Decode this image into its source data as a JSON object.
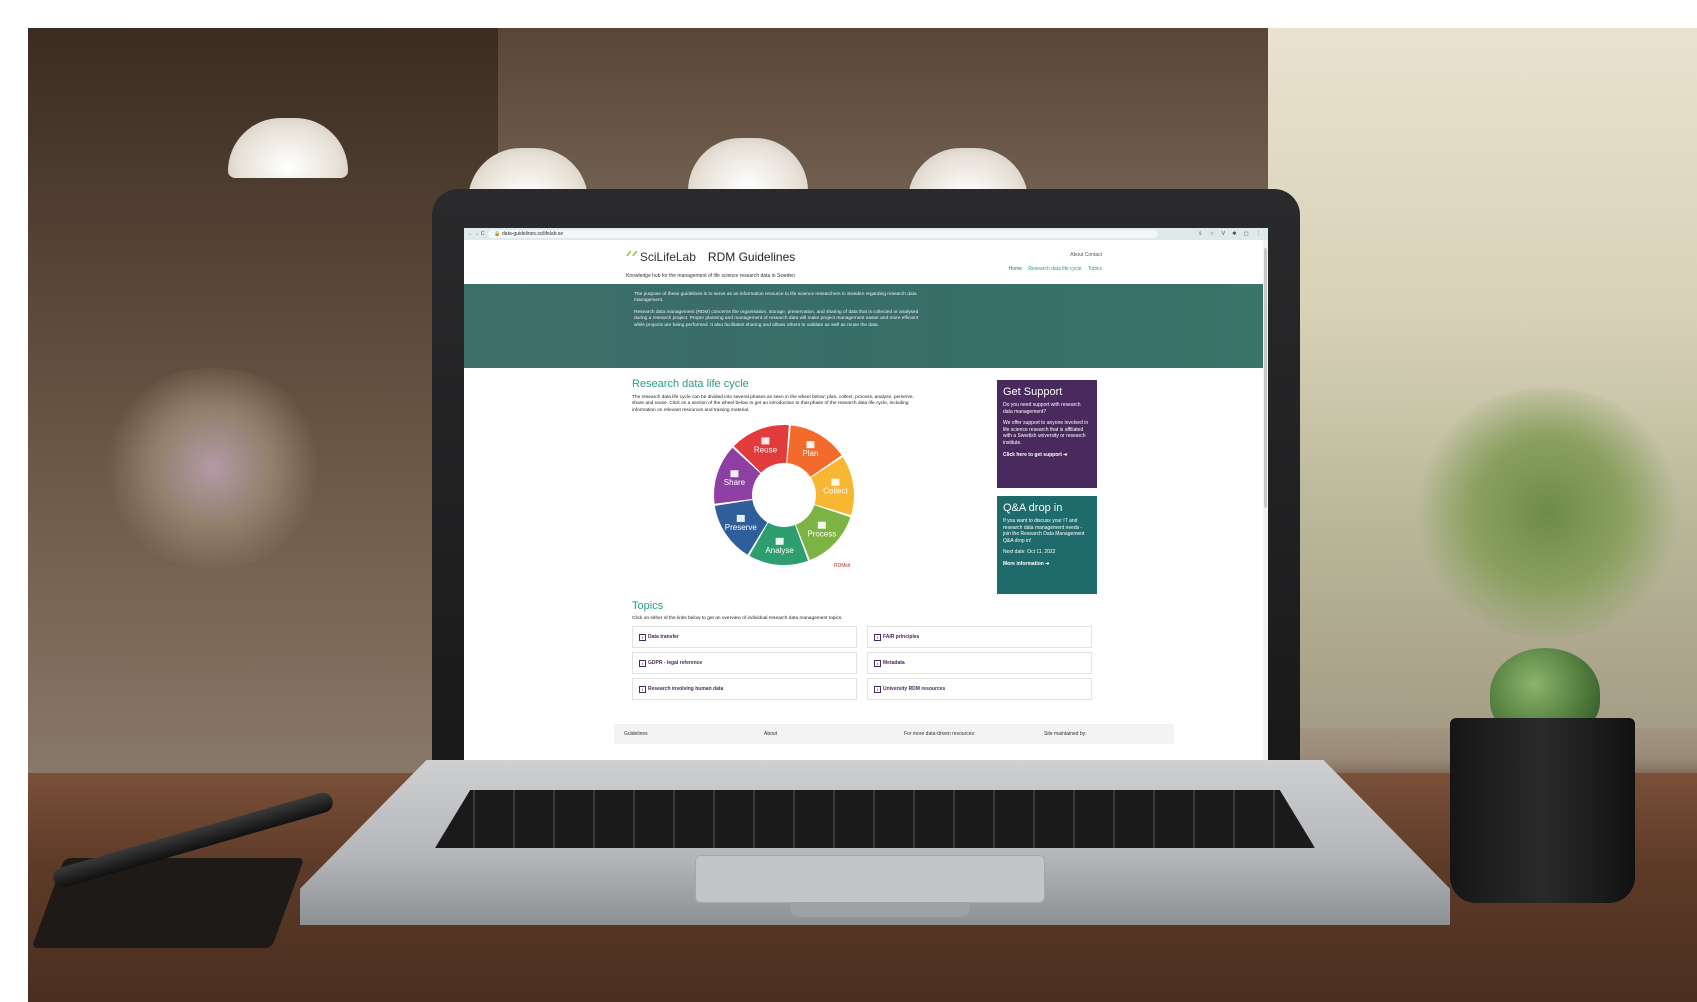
{
  "browser": {
    "url": "data-guidelines.scilifelab.se",
    "nav_icons": "← → C",
    "toolbar_icons": "⇪ ☆ V ✱ ▢ ⋮"
  },
  "header": {
    "logo_mark": "ᐟᐟ",
    "logo_text": "SciLifeLab",
    "site_title": "RDM Guidelines",
    "tagline": "Knowledge hub for the management of life science research data in Sweden",
    "top_links": [
      "About",
      "Contact"
    ],
    "main_nav": [
      "Home",
      "Research data life cycle",
      "Topics"
    ]
  },
  "hero": {
    "p1": "The purpose of these guidelines is to serve as an information resource to life science researchers in Sweden regarding research data management.",
    "p2": "Research data management (RDM) concerns the organisation, storage, preservation, and sharing of data that is collected or analysed during a research project. Proper planning and management of research data will make project management easier and more efficient while projects are being performed. It also facilitates sharing and allows others to validate as well as reuse the data."
  },
  "lifecycle": {
    "title": "Research data life cycle",
    "text": "The research data life cycle can be divided into several phases as seen in the wheel below; plan, collect, process, analyse, perserve, share and reuse. Click on a section of the wheel below to get an introduction to that phase of the research data life cycle, including information on relevant resources and training material.",
    "segments": [
      {
        "label": "Reuse",
        "color": "#e23b3b"
      },
      {
        "label": "Plan",
        "color": "#f26b2a"
      },
      {
        "label": "Collect",
        "color": "#f7b733"
      },
      {
        "label": "Process",
        "color": "#7cb342"
      },
      {
        "label": "Analyse",
        "color": "#2e9e6e"
      },
      {
        "label": "Preserve",
        "color": "#2f5f9a"
      },
      {
        "label": "Share",
        "color": "#8e3fa3"
      }
    ],
    "credit": "RDMkit"
  },
  "support": {
    "title": "Get Support",
    "p1": "Do you need support with research data management?",
    "p2": "We offer support to anyone involved in life science research that is affiliated with a Swedish university or research institute.",
    "link": "Click here to get support ➔"
  },
  "qa": {
    "title": "Q&A drop in",
    "p1": "If you want to discuss your IT and research data management needs - join the Research Data Management Q&A drop in!",
    "p2": "Next date: Oct 11, 2022",
    "link": "More information ➔"
  },
  "topics": {
    "title": "Topics",
    "text": "Click on either of the links below to get an overview of individual research data management topics.",
    "items": [
      "Data transfer",
      "FAIR principles",
      "GDPR - legal reference",
      "Metadata",
      "Research involving human data",
      "University RDM resources"
    ]
  },
  "footer": {
    "cols": [
      "Guidelines",
      "About",
      "For more data-driven resources:",
      "Site maintained by:"
    ]
  }
}
